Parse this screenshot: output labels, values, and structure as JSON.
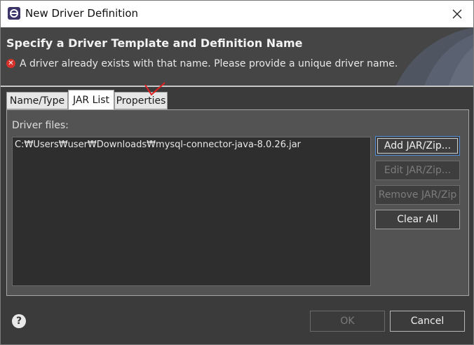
{
  "window": {
    "title": "New Driver Definition",
    "close_icon": "close-icon",
    "app_icon": "eclipse-icon"
  },
  "banner": {
    "title": "Specify a Driver Template and Definition Name",
    "message": "A driver already exists with that name. Please provide a unique driver name.",
    "message_icon": "error-icon"
  },
  "tabs": [
    {
      "label": "Name/Type",
      "active": false
    },
    {
      "label": "JAR List",
      "active": true
    },
    {
      "label": "Properties",
      "active": false
    }
  ],
  "jar_list": {
    "files_label": "Driver files:",
    "files": [
      "C:₩Users₩user₩Downloads₩mysql-connector-java-8.0.26.jar"
    ],
    "buttons": {
      "add": {
        "label": "Add JAR/Zip...",
        "enabled": true
      },
      "edit": {
        "label": "Edit JAR/Zip...",
        "enabled": false
      },
      "remove": {
        "label": "Remove JAR/Zip",
        "enabled": false
      },
      "clear": {
        "label": "Clear All",
        "enabled": true
      }
    }
  },
  "footer": {
    "help_icon": "help-icon",
    "ok_label": "OK",
    "ok_enabled": false,
    "cancel_label": "Cancel"
  },
  "colors": {
    "dialog_bg": "#3b3b3b",
    "banner_bg": "#454545",
    "panel_bg": "#535353",
    "list_bg": "#2e2e2e",
    "error": "#d8312a",
    "annotation": "#e02020",
    "focus": "#4f8ad6"
  }
}
